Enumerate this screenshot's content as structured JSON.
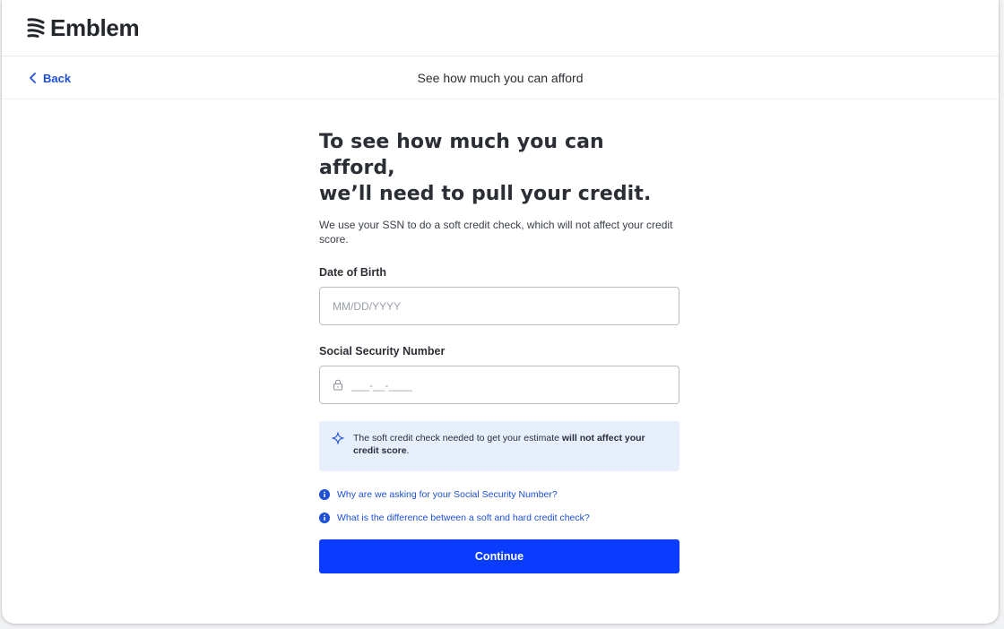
{
  "brand": {
    "name": "Emblem",
    "icon": "emblem-logo-icon"
  },
  "nav": {
    "back_label": "Back",
    "page_title": "See how much you can afford"
  },
  "form": {
    "headline_line1": "To see how much you can afford,",
    "headline_line2": "we’ll need to pull your credit.",
    "subtext": "We use your SSN to do a soft credit check, which will not affect your credit score.",
    "dob_label": "Date of Birth",
    "dob_placeholder": "MM/DD/YYYY",
    "dob_value": "",
    "ssn_label": "Social Security Number",
    "ssn_placeholder": "___-__-____",
    "ssn_value": "",
    "notice_prefix": "The soft credit check needed to get your estimate ",
    "notice_bold": "will not affect your credit score",
    "notice_suffix": ".",
    "faq_1": "Why are we asking for your Social Security Number?",
    "faq_2": "What is the difference between a soft and hard credit check?",
    "continue_label": "Continue"
  },
  "colors": {
    "accent": "#0a3cff",
    "link": "#1e4fd6",
    "notice_bg": "#e7effd"
  }
}
